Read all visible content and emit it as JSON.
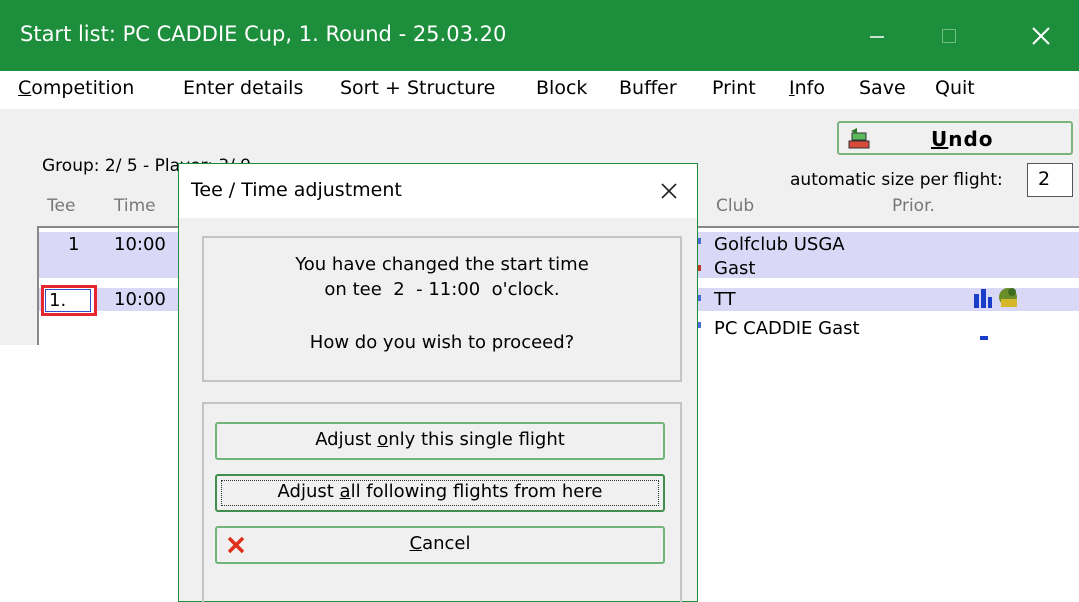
{
  "window": {
    "title": "Start list: PC CADDIE Cup, 1. Round - 25.03.20"
  },
  "menu": [
    {
      "first": "C",
      "rest": "ompetition"
    },
    {
      "first": "",
      "rest": "Enter details"
    },
    {
      "first": "",
      "rest": "Sort + Structure"
    },
    {
      "first": "",
      "rest": "Block"
    },
    {
      "first": "",
      "rest": "Buffer"
    },
    {
      "first": "",
      "rest": "Print"
    },
    {
      "first": "I",
      "rest": "nfo"
    },
    {
      "first": "",
      "rest": "Save"
    },
    {
      "first": "",
      "rest": "Quit"
    }
  ],
  "toolbar": {
    "undo_label": "Undo",
    "auto_size_label": "automatic size per flight:",
    "auto_size_value": "2"
  },
  "status": {
    "group_player": "Group:  2/ 5 - Player:  3/ 9"
  },
  "columns": {
    "tee": "Tee",
    "time": "Time",
    "club": "Club",
    "prior": "Prior."
  },
  "rows": [
    {
      "tee": "1",
      "time": "10:00",
      "club": "Golfclub USGA"
    },
    {
      "tee": "",
      "time": "",
      "club": "Gast"
    },
    {
      "tee": "1.",
      "time": "10:00",
      "club": "TT"
    },
    {
      "tee": "",
      "time": "",
      "club": "PC CADDIE Gast"
    }
  ],
  "dialog": {
    "title": "Tee / Time adjustment",
    "message_line1": "You have changed the start time",
    "message_line2": "on tee  2  - 11:00  o'clock.",
    "message_line3": "How do you wish to proceed?",
    "btn_single_pre": "Adjust ",
    "btn_single_ul": "o",
    "btn_single_post": "nly this single flight",
    "btn_all_pre": "Adjust ",
    "btn_all_ul": "a",
    "btn_all_post": "ll following flights from here",
    "btn_cancel_ul": "C",
    "btn_cancel_post": "ancel"
  },
  "colors": {
    "titlebar": "#1d8f3c",
    "selection": "#d9d9f7",
    "highlight": "#e8262e"
  }
}
